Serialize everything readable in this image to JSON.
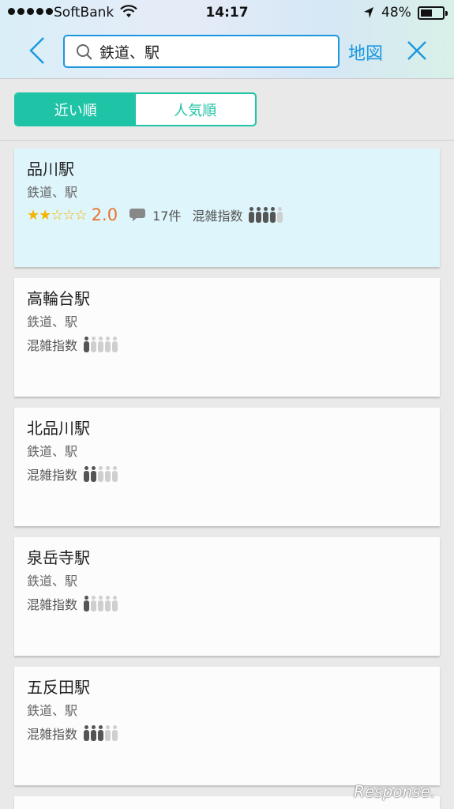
{
  "status_bar": {
    "carrier": "SoftBank",
    "time": "14:17",
    "battery": "48%"
  },
  "search": {
    "query": "鉄道、駅",
    "map_label": "地図"
  },
  "sort_tabs": [
    {
      "label": "近い順",
      "active": true
    },
    {
      "label": "人気順",
      "active": false
    }
  ],
  "results": [
    {
      "name": "品川駅",
      "category": "鉄道、駅",
      "stars": "★★☆☆☆",
      "rating": "2.0",
      "reviews": "17件",
      "congestion_label": "混雑指数",
      "congestion_level": 4,
      "selected": true
    },
    {
      "name": "高輪台駅",
      "category": "鉄道、駅",
      "congestion_label": "混雑指数",
      "congestion_level": 1
    },
    {
      "name": "北品川駅",
      "category": "鉄道、駅",
      "congestion_label": "混雑指数",
      "congestion_level": 2
    },
    {
      "name": "泉岳寺駅",
      "category": "鉄道、駅",
      "congestion_label": "混雑指数",
      "congestion_level": 1
    },
    {
      "name": "五反田駅",
      "category": "鉄道、駅",
      "congestion_label": "混雑指数",
      "congestion_level": 3
    }
  ],
  "watermark": "Response.",
  "colors": {
    "accent_blue": "#1b98e0",
    "accent_teal": "#1fc3a6",
    "rating_orange": "#e8732a",
    "star_gold": "#f5b400"
  }
}
